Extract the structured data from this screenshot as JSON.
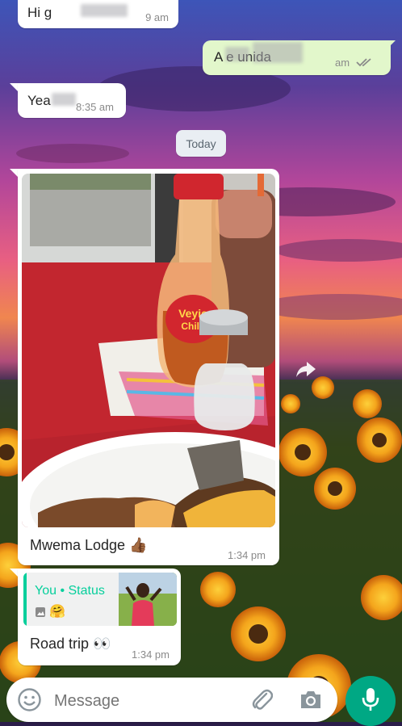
{
  "chat": {
    "messages": [
      {
        "text": "Hi g",
        "time": "9 am"
      },
      {
        "text": "A e unida",
        "time": "am"
      },
      {
        "text": "Yea",
        "time": "8:35 am"
      }
    ],
    "date_divider": "Today",
    "photo_message": {
      "caption": "Mwema Lodge",
      "emoji": "👍🏾",
      "time": "1:34 pm"
    },
    "status_reply": {
      "quote_author": "You • Status",
      "quote_emoji": "🤗",
      "text": "Road trip",
      "emoji": "👀",
      "time": "1:34 pm"
    },
    "photo_bottle_label": [
      "Veyie",
      "Chilli"
    ]
  },
  "input": {
    "placeholder": "Message"
  },
  "icons": [
    "emoji-icon",
    "attach-icon",
    "camera-icon",
    "mic-icon",
    "forward-icon",
    "read-receipt-icon",
    "image-icon"
  ],
  "colors": {
    "outgoing_bubble": "#e2f7cb",
    "incoming_bubble": "#ffffff",
    "accent": "#00a884",
    "status_bar": "#06cf9c",
    "read_ticks": "#8a8a8a"
  }
}
